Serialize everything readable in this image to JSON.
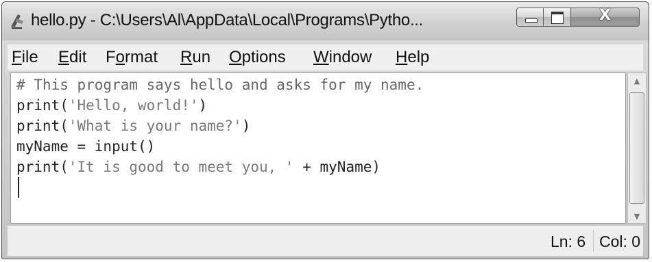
{
  "window": {
    "title": "hello.py - C:\\Users\\Al\\AppData\\Local\\Programs\\Pytho..."
  },
  "controls": {
    "minimize_icon": "minimize-icon",
    "maximize_icon": "maximize-icon",
    "close_icon": "close-icon",
    "close_glyph": "X"
  },
  "menu": {
    "items": [
      {
        "label": "File",
        "mnemonic": "F"
      },
      {
        "label": "Edit",
        "mnemonic": "E"
      },
      {
        "label": "Format",
        "mnemonic": "o"
      },
      {
        "label": "Run",
        "mnemonic": "R"
      },
      {
        "label": "Options",
        "mnemonic": "O"
      },
      {
        "label": "Window",
        "mnemonic": "W"
      },
      {
        "label": "Help",
        "mnemonic": "H"
      }
    ]
  },
  "editor": {
    "lines": [
      {
        "parts": [
          {
            "text": "# This program says hello and asks for my name.",
            "kind": "comment"
          }
        ]
      },
      {
        "parts": [
          {
            "text": "print(",
            "kind": "code"
          },
          {
            "text": "'Hello, world!'",
            "kind": "str"
          },
          {
            "text": ")",
            "kind": "code"
          }
        ]
      },
      {
        "parts": [
          {
            "text": "print(",
            "kind": "code"
          },
          {
            "text": "'What is your name?'",
            "kind": "str"
          },
          {
            "text": ")",
            "kind": "code"
          }
        ]
      },
      {
        "parts": [
          {
            "text": "myName = input()",
            "kind": "code"
          }
        ]
      },
      {
        "parts": [
          {
            "text": "print(",
            "kind": "code"
          },
          {
            "text": "'It is good to meet you, '",
            "kind": "str"
          },
          {
            "text": " + myName)",
            "kind": "code"
          }
        ]
      }
    ]
  },
  "status": {
    "line": "Ln: 6",
    "column": "Col: 0"
  },
  "colors": {
    "comment": "#666666",
    "string": "#7a7a7a",
    "code": "#222222"
  }
}
